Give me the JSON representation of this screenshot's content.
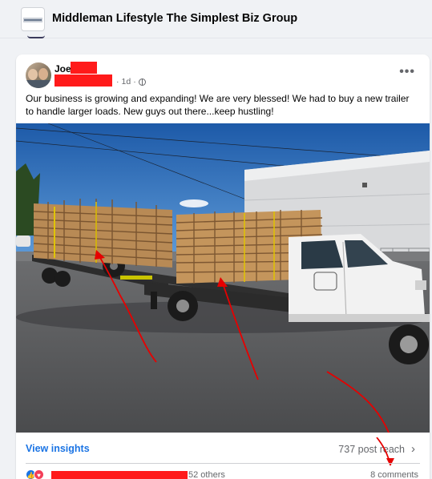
{
  "header": {
    "group_name": "Middleman Lifestyle The Simplest Biz Group",
    "thumb_icon": "group-cover-thumbnail"
  },
  "post": {
    "author": "Joe",
    "time": "1d",
    "visibility_icon": "globe-icon",
    "more_icon": "more-options-icon",
    "more_label": "•••",
    "text": "Our business is growing and expanding! We are very blessed! We had to buy a new trailer to handle larger loads. New guys out there...keep hustling!",
    "separator": "·"
  },
  "footer": {
    "insights_label": "View insights",
    "reach_label": "737 post reach",
    "chevron": "›",
    "others_label": "52 others",
    "comments_label": "8 comments",
    "like_glyph": "👍",
    "love_glyph": "♥"
  },
  "colors": {
    "accent": "#1b74e4",
    "redaction": "#ff1a1a",
    "annotation_arrows": "#e60000"
  }
}
